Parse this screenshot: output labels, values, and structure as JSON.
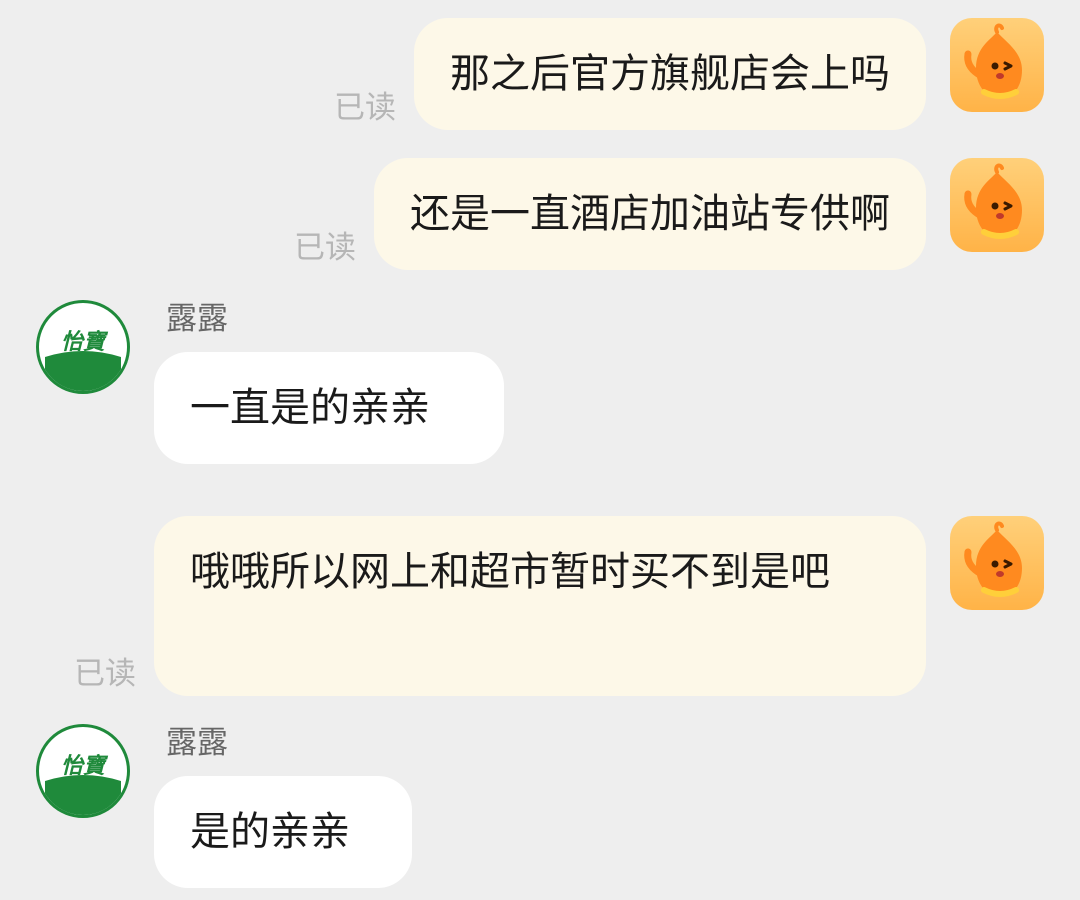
{
  "conversation": {
    "messages": [
      {
        "direction": "out",
        "text": "那之后官方旗舰店会上吗",
        "status": "已读",
        "avatar_icon": "orange-mascot-icon"
      },
      {
        "direction": "out",
        "text": "还是一直酒店加油站专供啊",
        "status": "已读",
        "avatar_icon": "orange-mascot-icon"
      },
      {
        "direction": "in",
        "sender": "露露",
        "text": "一直是的亲亲",
        "avatar_icon": "yibao-logo-icon",
        "avatar_text": "怡寶"
      },
      {
        "direction": "out",
        "text": "哦哦所以网上和超市暂时买不到是吧",
        "status": "已读",
        "avatar_icon": "orange-mascot-icon"
      },
      {
        "direction": "in",
        "sender": "露露",
        "text": "是的亲亲",
        "avatar_icon": "yibao-logo-icon",
        "avatar_text": "怡寶"
      }
    ]
  },
  "colors": {
    "background": "#eeeeee",
    "outgoing_bubble": "#fdf8e8",
    "incoming_bubble": "#ffffff",
    "brand_green": "#1f8a3b",
    "mascot_orange": "#ff8a1f"
  }
}
